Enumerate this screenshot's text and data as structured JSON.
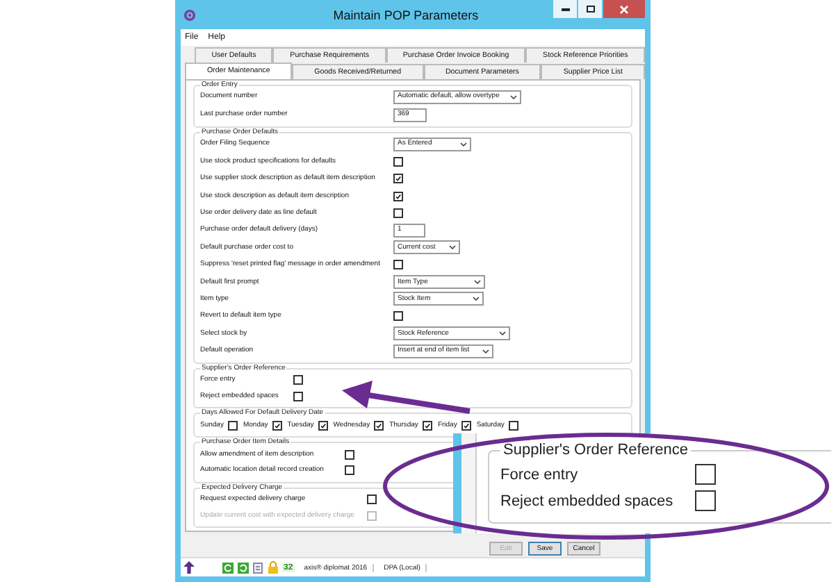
{
  "window": {
    "title": "Maintain POP Parameters"
  },
  "menu": [
    "File",
    "Help"
  ],
  "tab_rows": [
    [
      {
        "label": "User Defaults",
        "selected": false
      },
      {
        "label": "Purchase Requirements",
        "selected": false
      },
      {
        "label": "Purchase Order Invoice Booking",
        "selected": false
      },
      {
        "label": "Stock Reference Priorities",
        "selected": false
      }
    ],
    [
      {
        "label": "Order Maintenance",
        "selected": true
      },
      {
        "label": "Goods Received/Returned",
        "selected": false
      },
      {
        "label": "Document Parameters",
        "selected": false
      },
      {
        "label": "Supplier Price List",
        "selected": false
      }
    ]
  ],
  "sections": [
    {
      "kind": "rows",
      "title": "Order Entry",
      "fields": [
        {
          "kind": "select",
          "label": "Document number",
          "value": "Automatic default, allow overtype"
        },
        {
          "kind": "text",
          "label": "Last purchase order number",
          "value": "369"
        }
      ]
    },
    {
      "kind": "rows",
      "title": "Purchase Order Defaults",
      "fields": [
        {
          "kind": "select",
          "label": "Order Filing Sequence",
          "value": "As Entered"
        },
        {
          "kind": "checkbox",
          "label": "Use stock product specifications for defaults",
          "checked": false,
          "disabled": false
        },
        {
          "kind": "checkbox",
          "label": "Use supplier stock description as default item description",
          "checked": true,
          "disabled": false
        },
        {
          "kind": "checkbox",
          "label": "Use stock description as default item description",
          "checked": true,
          "disabled": false
        },
        {
          "kind": "checkbox",
          "label": "Use order delivery date as line default",
          "checked": false,
          "disabled": false
        },
        {
          "kind": "text",
          "label": "Purchase order default delivery (days)",
          "value": "1"
        },
        {
          "kind": "select",
          "label": "Default purchase order cost to",
          "value": "Current cost"
        },
        {
          "kind": "checkbox",
          "label": "Suppress 'reset printed flag' message in order amendment",
          "checked": false,
          "disabled": false
        },
        {
          "kind": "select",
          "label": "Default first prompt",
          "value": "Item Type"
        },
        {
          "kind": "select",
          "label": "Item type",
          "value": "Stock Item"
        },
        {
          "kind": "checkbox",
          "label": "Revert to default item type",
          "checked": false,
          "disabled": false
        },
        {
          "kind": "select",
          "label": "Select stock by",
          "value": "Stock Reference"
        },
        {
          "kind": "select",
          "label": "Default operation",
          "value": "Insert at end of item list"
        }
      ]
    },
    {
      "kind": "rows",
      "title": "Supplier's Order Reference",
      "fields": [
        {
          "kind": "checkbox",
          "label": "Force entry",
          "checked": false,
          "disabled": false
        },
        {
          "kind": "checkbox",
          "label": "Reject embedded spaces",
          "checked": false,
          "disabled": false
        }
      ]
    },
    {
      "kind": "days",
      "title": "Days Allowed For Default Delivery Date",
      "days": [
        {
          "label": "Sunday",
          "checked": false
        },
        {
          "label": "Monday",
          "checked": true
        },
        {
          "label": "Tuesday",
          "checked": true
        },
        {
          "label": "Wednesday",
          "checked": true
        },
        {
          "label": "Thursday",
          "checked": true
        },
        {
          "label": "Friday",
          "checked": true
        },
        {
          "label": "Saturday",
          "checked": false
        }
      ]
    },
    {
      "kind": "rows",
      "title": "Purchase Order Item Details",
      "fields": [
        {
          "kind": "checkbox",
          "label": "Allow amendment of item description",
          "checked": false,
          "disabled": false
        },
        {
          "kind": "checkbox",
          "label": "Automatic location detail record creation",
          "checked": false,
          "disabled": false
        }
      ]
    },
    {
      "kind": "rows",
      "title": "Expected Delivery Charge",
      "fields": [
        {
          "kind": "checkbox",
          "label": "Request expected delivery charge",
          "checked": false,
          "disabled": false
        },
        {
          "kind": "checkbox",
          "label": "Update current cost with expected delivery charge",
          "checked": false,
          "disabled": true
        }
      ]
    }
  ],
  "buttons": [
    {
      "label": "Edit",
      "disabled": true
    },
    {
      "label": "Save",
      "disabled": false
    },
    {
      "label": "Cancel",
      "disabled": false
    }
  ],
  "status_bar": {
    "count": "32",
    "product": "axis® diplomat 2016",
    "database": "DPA (Local)"
  },
  "callout": {
    "title": "Supplier's Order Reference",
    "fields": [
      {
        "label": "Force entry",
        "checked": false
      },
      {
        "label": "Reject embedded spaces",
        "checked": false
      }
    ]
  }
}
